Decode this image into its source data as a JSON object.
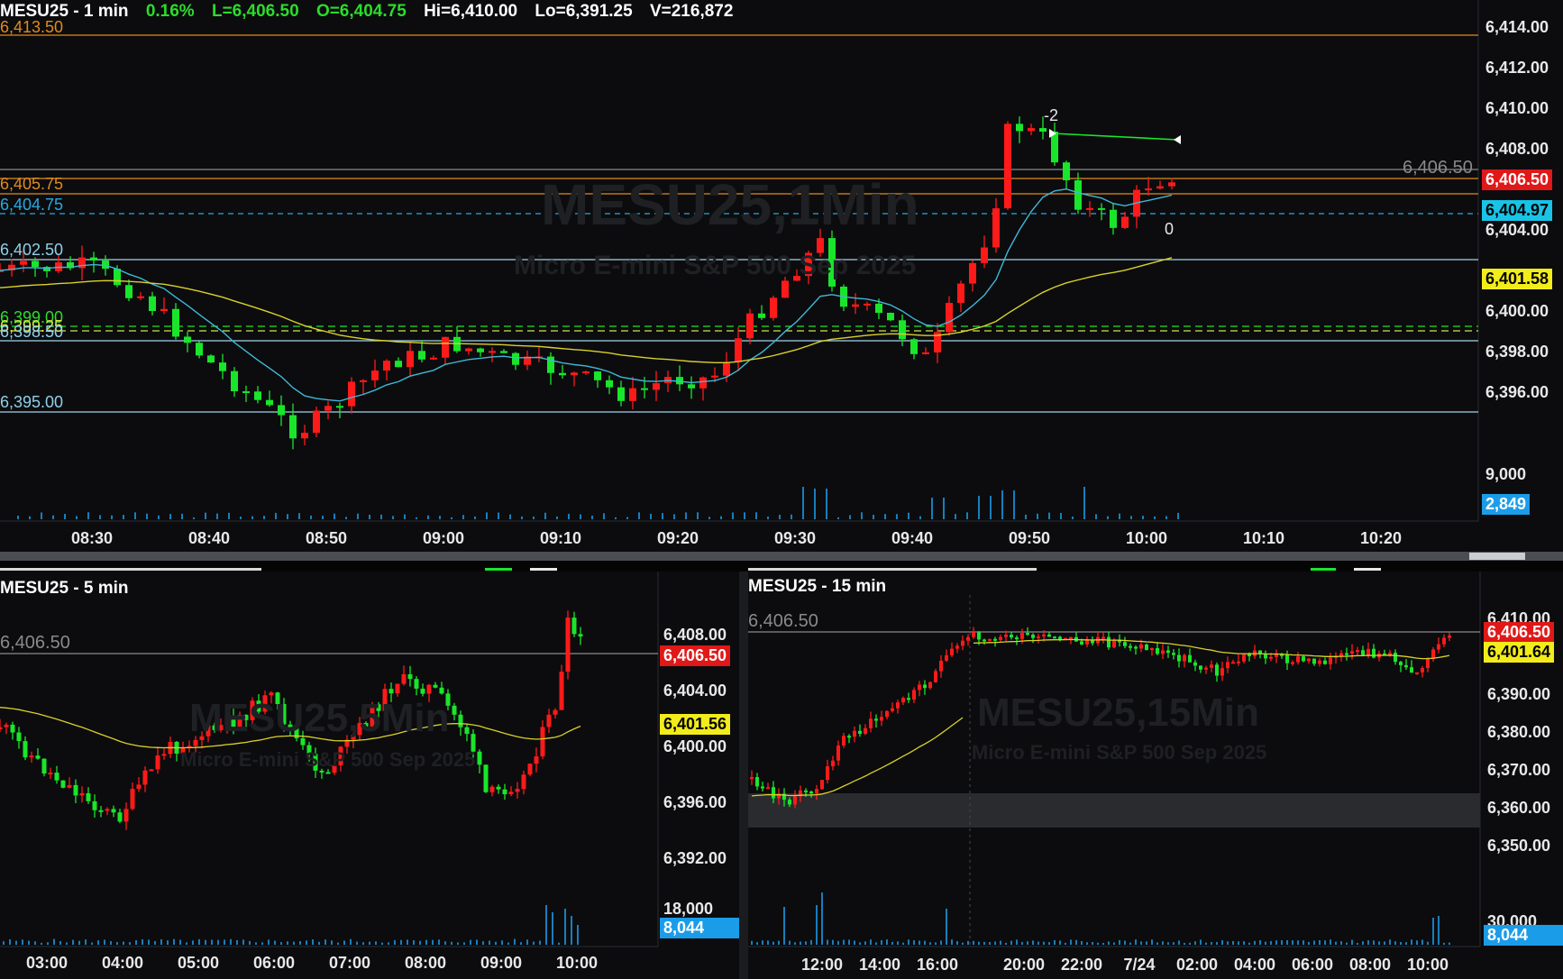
{
  "top": {
    "symbol": "MESU25 - 1 min",
    "change": "0.16%",
    "last": "L=6,406.50",
    "open": "O=6,404.75",
    "high": "Hi=6,410.00",
    "low": "Lo=6,391.25",
    "volume": "V=216,872",
    "watermark_title": "MESU25,1Min",
    "watermark_sub": "Micro E-mini S&P 500 Sep 2025",
    "price_axis": [
      "6,414.00",
      "6,412.00",
      "6,410.00",
      "6,408.00",
      "6,404.00",
      "6,400.00",
      "6,398.00",
      "6,396.00"
    ],
    "volume_axis": "9,000",
    "time_axis": [
      "08:30",
      "08:40",
      "08:50",
      "09:00",
      "09:10",
      "09:20",
      "09:30",
      "09:40",
      "09:50",
      "10:00",
      "10:10",
      "10:20"
    ],
    "levels": {
      "orange_top": "6,413.50",
      "orange_mid": "6,405.75",
      "blue_dash": "6,404.75",
      "white_1": "6,402.50",
      "green_1": "6,399.00",
      "green_2": "6,399.25",
      "white_2": "6,398.50",
      "white_3": "6,395.00"
    },
    "last_price_line": "6,406.50",
    "tags": {
      "last": "6,406.50",
      "ema_fast": "6,404.97",
      "ema_slow": "6,401.58",
      "volume": "2,849"
    },
    "annotations": {
      "neg": "-2",
      "zero": "0"
    }
  },
  "bottom_left": {
    "symbol": "MESU25 - 5 min",
    "watermark_title": "MESU25,5Min",
    "watermark_sub": "Micro E-mini S&P 500 Sep 2025",
    "price_axis": [
      "6,408.00",
      "6,404.00",
      "6,400.00",
      "6,396.00",
      "6,392.00"
    ],
    "volume_axis": "18,000",
    "last_price_line": "6,406.50",
    "tags": {
      "last": "6,406.50",
      "ema": "6,401.56",
      "volume": "8,044"
    },
    "time_axis": [
      "03:00",
      "04:00",
      "05:00",
      "06:00",
      "07:00",
      "08:00",
      "09:00",
      "10:00"
    ]
  },
  "bottom_right": {
    "symbol": "MESU25 - 15 min",
    "watermark_title": "MESU25,15Min",
    "watermark_sub": "Micro E-mini S&P 500 Sep 2025",
    "price_axis": [
      "6,410.00",
      "6,390.00",
      "6,380.00",
      "6,370.00",
      "6,360.00",
      "6,350.00"
    ],
    "volume_axis": "30,000",
    "last_price_line": "6,406.50",
    "tags": {
      "last": "6,406.50",
      "ema": "6,401.64",
      "volume": "8,044"
    },
    "time_axis": [
      "12:00",
      "14:00",
      "16:00",
      "20:00",
      "22:00",
      "7/24",
      "02:00",
      "04:00",
      "06:00",
      "08:00",
      "10:00"
    ]
  },
  "colors": {
    "up": "#19e62a",
    "down": "#ff1a1a",
    "ema_fast": "#3fb8d6",
    "ema_slow": "#d9d12a",
    "orange_level": "#e08a1e",
    "blue_level": "#2aa8e0",
    "tag_red": "#e01818",
    "tag_cyan": "#19c3e6",
    "tag_yellow": "#f1ec1a",
    "tag_blue": "#1b9ce8"
  }
}
